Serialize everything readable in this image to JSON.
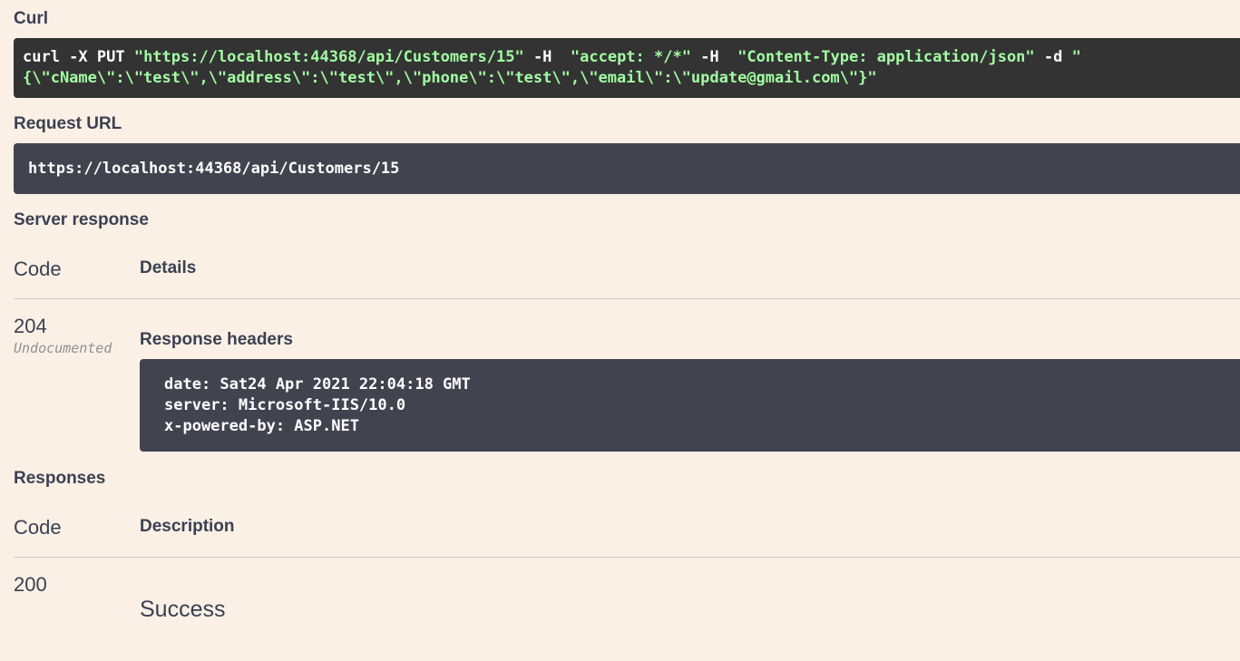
{
  "curl": {
    "title": "Curl",
    "cmd_1": "curl -X PUT ",
    "url": "\"https://localhost:44368/api/Customers/15\"",
    "flag_h1": " -H  ",
    "accept": "\"accept: */*\"",
    "flag_h2": " -H  ",
    "content_type": "\"Content-Type: application/json\"",
    "flag_d": " -d ",
    "body_open": "\"",
    "body": "{\\\"cName\\\":\\\"test\\\",\\\"address\\\":\\\"test\\\",\\\"phone\\\":\\\"test\\\",\\\"email\\\":\\\"update@gmail.com\\\"}\""
  },
  "request_url": {
    "title": "Request URL",
    "value": "https://localhost:44368/api/Customers/15"
  },
  "server_response": {
    "title": "Server response",
    "col_code": "Code",
    "col_details": "Details",
    "code": "204",
    "undocumented": "Undocumented",
    "headers_title": "Response headers",
    "headers": [
      "date: Sat24 Apr 2021 22:04:18 GMT",
      "server: Microsoft-IIS/10.0",
      "x-powered-by: ASP.NET"
    ]
  },
  "responses": {
    "title": "Responses",
    "col_code": "Code",
    "col_description": "Description",
    "code": "200",
    "description": "Success"
  }
}
